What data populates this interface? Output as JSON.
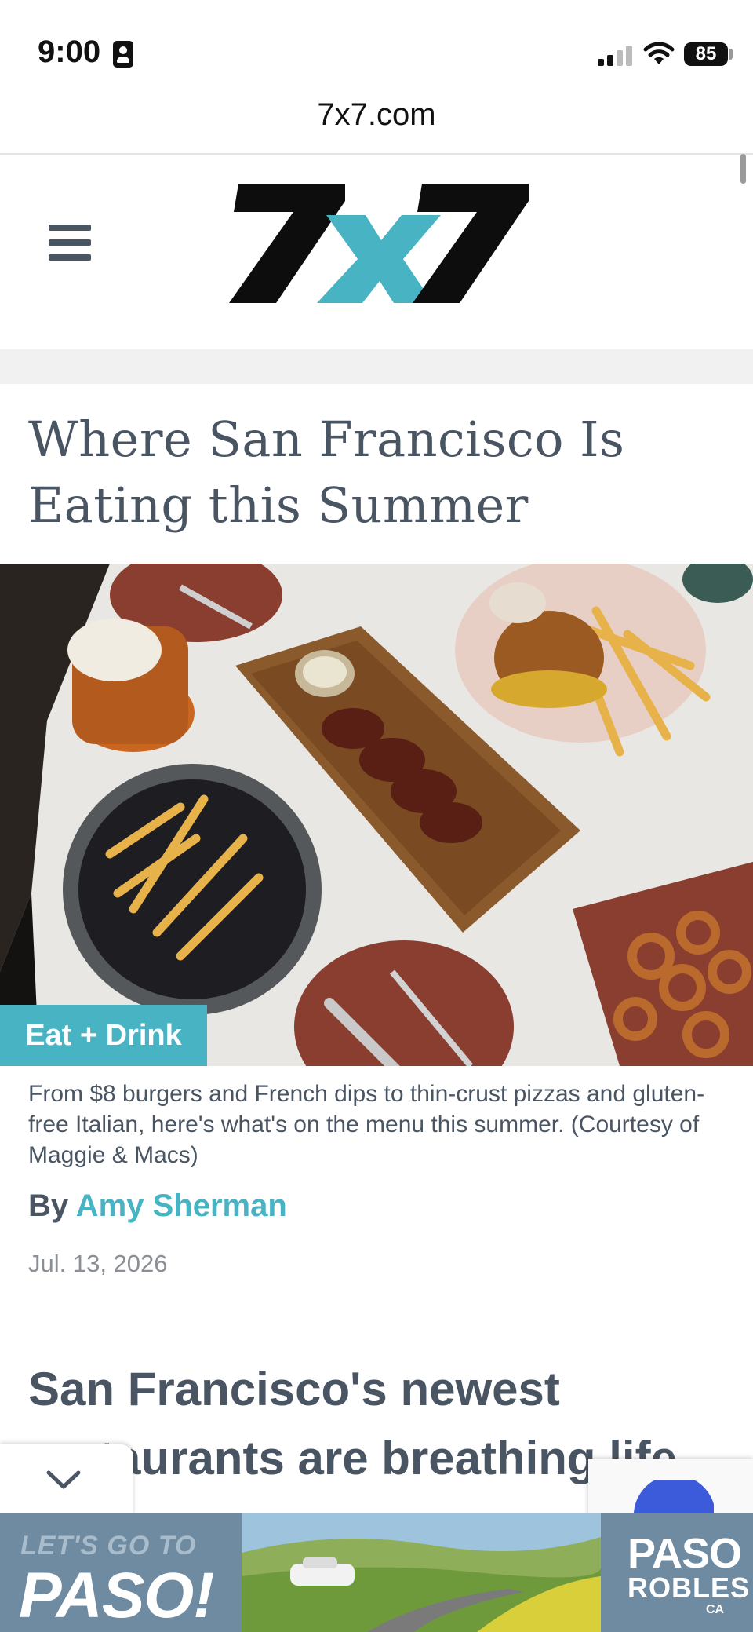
{
  "status_bar": {
    "time": "9:00",
    "battery": "85"
  },
  "browser": {
    "url": "7x7.com"
  },
  "site": {
    "logo": "7x7",
    "colors": {
      "accent": "#48b3c3",
      "text": "#4a5563"
    }
  },
  "article": {
    "title": "Where San Francisco Is Eating this Summer",
    "category": "Eat + Drink",
    "caption": "From $8 burgers and French dips to thin-crust pizzas and gluten-free Italian, here's what's on the menu this summer. (Courtesy of Maggie & Macs)",
    "byline_prefix": "By",
    "author": "Amy Sherman",
    "date": "Jul. 13, 2026",
    "subhead": "San Francisco's newest restaurants are breathing life"
  },
  "ad": {
    "tagline": "LET'S GO TO",
    "headline": "PASO!",
    "brand_line1": "PASO",
    "brand_line2": "ROBLES",
    "brand_suffix": "CA"
  }
}
